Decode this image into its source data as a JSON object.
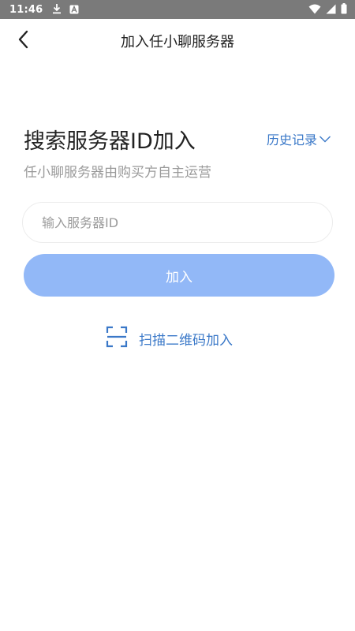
{
  "status_bar": {
    "time": "11:46",
    "icons": [
      "download-icon",
      "text-a-icon",
      "wifi-icon",
      "signal-icon",
      "battery-icon"
    ]
  },
  "header": {
    "title": "加入任小聊服务器",
    "back_icon": "chevron-left-icon"
  },
  "main": {
    "heading": "搜索服务器ID加入",
    "history_label": "历史记录",
    "history_icon": "chevron-down-icon",
    "subtitle": "任小聊服务器由购买方自主运营",
    "server_input": {
      "value": "",
      "placeholder": "输入服务器ID"
    },
    "join_label": "加入",
    "scan_label": "扫描二维码加入",
    "scan_icon": "qr-scan-icon"
  },
  "colors": {
    "status_bar_bg": "#7a7a7a",
    "accent_blue": "#3a78c8",
    "button_bg": "#92b8f7",
    "heading_text": "#222222",
    "muted_text": "#9a9a9a"
  }
}
